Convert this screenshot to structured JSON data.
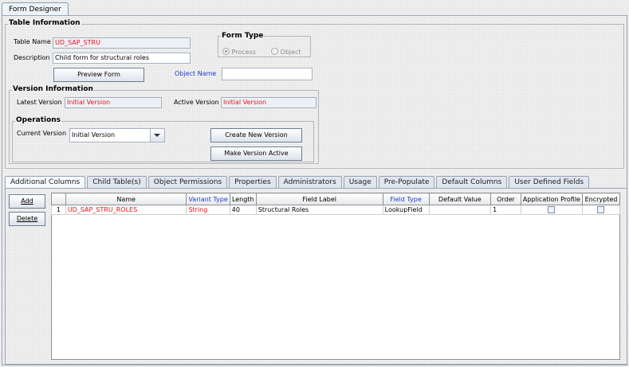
{
  "window": {
    "tab_title": "Form Designer"
  },
  "table_info": {
    "title": "Table Information",
    "table_name_label": "Table Name",
    "table_name_value": "UD_SAP_STRU",
    "description_label": "Description",
    "description_value": "Child form for structural roles",
    "preview_button": "Preview Form",
    "object_name_label": "Object Name",
    "object_name_value": "",
    "form_type": {
      "title": "Form Type",
      "options": [
        "Process",
        "Object"
      ],
      "selected": "Process"
    }
  },
  "version_info": {
    "title": "Version Information",
    "latest_label": "Latest Version",
    "latest_value": "Initial Version",
    "active_label": "Active Version",
    "active_value": "Initial Version"
  },
  "operations": {
    "title": "Operations",
    "current_version_label": "Current Version",
    "current_version_value": "Initial Version",
    "create_button": "Create New Version",
    "make_active_button": "Make Version Active"
  },
  "tabs": [
    "Additional Columns",
    "Child Table(s)",
    "Object Permissions",
    "Properties",
    "Administrators",
    "Usage",
    "Pre-Populate",
    "Default Columns",
    "User Defined Fields"
  ],
  "active_tab": "Additional Columns",
  "side_buttons": {
    "add": "Add",
    "delete": "Delete"
  },
  "grid": {
    "columns": [
      "",
      "Name",
      "Variant Type",
      "Length",
      "Field Label",
      "Field Type",
      "Default Value",
      "Order",
      "Application Profile",
      "Encrypted"
    ],
    "rows": [
      {
        "num": "1",
        "name": "UD_SAP_STRU_ROLES",
        "variant_type": "String",
        "length": "40",
        "field_label": "Structural Roles",
        "field_type": "LookupField",
        "default_value": "",
        "order": "1",
        "application_profile": false,
        "encrypted": false
      }
    ]
  },
  "colors": {
    "accent_red": "#e8101a",
    "accent_blue": "#1f3ccc"
  }
}
